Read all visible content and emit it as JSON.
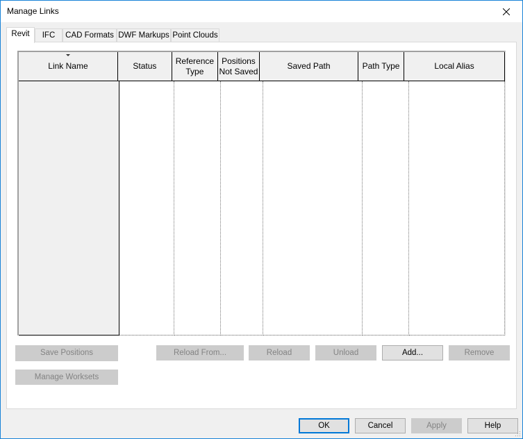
{
  "window": {
    "title": "Manage Links",
    "close_icon": "close-icon"
  },
  "tabs": [
    {
      "label": "Revit",
      "active": true
    },
    {
      "label": "IFC",
      "active": false
    },
    {
      "label": "CAD Formats",
      "active": false
    },
    {
      "label": "DWF Markups",
      "active": false
    },
    {
      "label": "Point Clouds",
      "active": false
    }
  ],
  "table": {
    "sort_indicator": "sort-descending-arrow",
    "columns": [
      {
        "label": "Link Name",
        "sorted": true
      },
      {
        "label": "Status"
      },
      {
        "label": "Reference Type"
      },
      {
        "label": "Positions Not Saved"
      },
      {
        "label": "Saved Path"
      },
      {
        "label": "Path Type"
      },
      {
        "label": "Local Alias"
      }
    ],
    "rows": []
  },
  "panel_buttons": {
    "save_positions": {
      "label": "Save Positions",
      "enabled": false
    },
    "manage_worksets": {
      "label": "Manage Worksets",
      "enabled": false
    },
    "reload_from": {
      "label": "Reload From...",
      "enabled": false
    },
    "reload": {
      "label": "Reload",
      "enabled": false
    },
    "unload": {
      "label": "Unload",
      "enabled": false
    },
    "add": {
      "label": "Add...",
      "enabled": true
    },
    "remove": {
      "label": "Remove",
      "enabled": false
    }
  },
  "dialog_buttons": {
    "ok": {
      "label": "OK",
      "enabled": true,
      "default": true
    },
    "cancel": {
      "label": "Cancel",
      "enabled": true
    },
    "apply": {
      "label": "Apply",
      "enabled": false
    },
    "help": {
      "label": "Help",
      "enabled": true
    }
  },
  "colors": {
    "accent": "#0078d7",
    "window_border": "#1883d7",
    "dialog_bg": "#f0f0f0",
    "disabled_button_bg": "#cccccc",
    "disabled_text": "#838383"
  }
}
